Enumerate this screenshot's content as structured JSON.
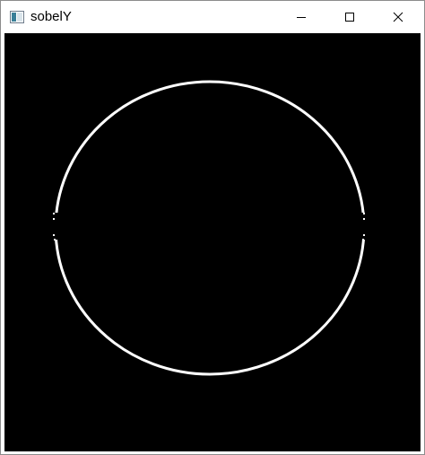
{
  "window": {
    "title": "sobelY",
    "icon": "opencv-window-icon",
    "controls": [
      "minimize",
      "maximize",
      "close"
    ]
  },
  "image_content": {
    "description_key": "sobel-y-edge-circle",
    "background_color": "#000000",
    "edge_color": "#ffffff"
  }
}
